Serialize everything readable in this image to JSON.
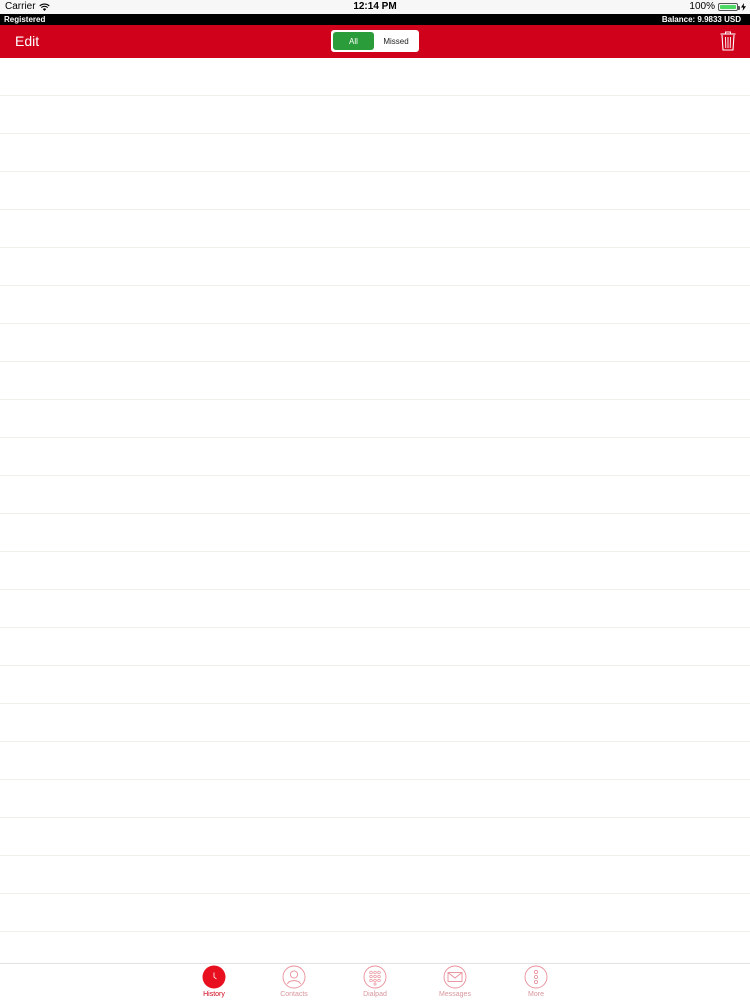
{
  "status_bar": {
    "carrier": "Carrier",
    "time": "12:14 PM",
    "battery_percent": "100%",
    "battery_level": 1.0,
    "wifi_icon": "wifi-icon",
    "charging_icon": "bolt-icon"
  },
  "registration": {
    "status": "Registered",
    "balance": "Balance: 9.9833 USD"
  },
  "nav": {
    "edit_label": "Edit",
    "segments": [
      "All",
      "Missed"
    ],
    "selected_segment": "All",
    "trash_icon": "trash-icon"
  },
  "colors": {
    "brand_red": "#d0021b",
    "selected_green": "#2a9d3a",
    "divider": "#eef0ea",
    "inactive_tab": "#d8969d"
  },
  "tabs": [
    {
      "label": "History",
      "icon": "clock-icon",
      "active": true
    },
    {
      "label": "Contacts",
      "icon": "person-icon",
      "active": false
    },
    {
      "label": "Dialpad",
      "icon": "dialpad-icon",
      "active": false
    },
    {
      "label": "Messages",
      "icon": "envelope-icon",
      "active": false
    },
    {
      "label": "More",
      "icon": "more-icon",
      "active": false
    }
  ]
}
